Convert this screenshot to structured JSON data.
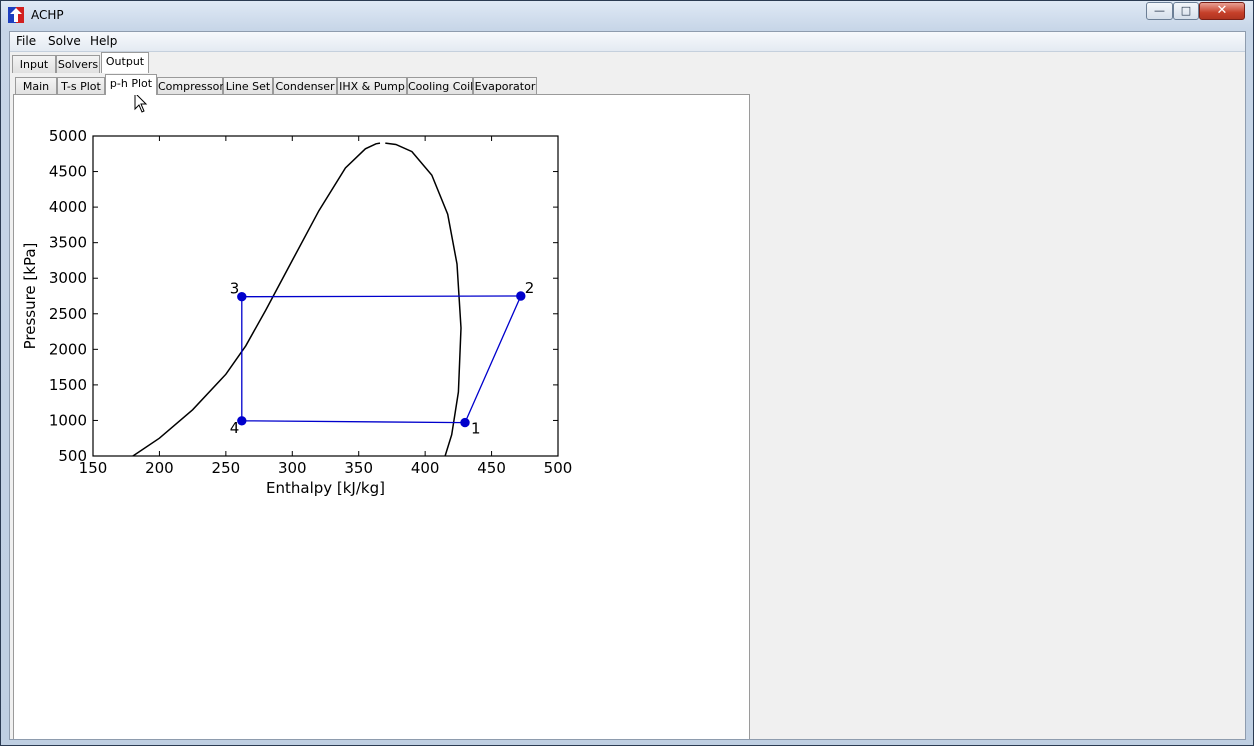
{
  "window": {
    "title": "ACHP"
  },
  "menu": [
    "File",
    "Solve",
    "Help"
  ],
  "main_tabs": [
    {
      "label": "Input"
    },
    {
      "label": "Solvers"
    },
    {
      "label": "Output",
      "selected": true
    }
  ],
  "output_tabs": [
    {
      "label": "Main"
    },
    {
      "label": "T-s Plot"
    },
    {
      "label": "p-h Plot",
      "selected": true
    },
    {
      "label": "Compressor"
    },
    {
      "label": "Line Set"
    },
    {
      "label": "Condenser"
    },
    {
      "label": "IHX & Pump"
    },
    {
      "label": "Cooling Coil"
    },
    {
      "label": "Evaporator"
    }
  ],
  "colors": {
    "cycle": "#0000cc",
    "dome": "#000000"
  },
  "chart_data": {
    "type": "line",
    "xlabel": "Enthalpy [kJ/kg]",
    "ylabel": "Pressure [kPa]",
    "xlim": [
      150,
      500
    ],
    "ylim": [
      500,
      5000
    ],
    "xticks": [
      150,
      200,
      250,
      300,
      350,
      400,
      450,
      500
    ],
    "yticks": [
      500,
      1000,
      1500,
      2000,
      2500,
      3000,
      3500,
      4000,
      4500,
      5000
    ],
    "grid": false,
    "series": [
      {
        "role": "saturation-dome-liquid",
        "x": [
          180,
          200,
          225,
          250,
          265,
          280,
          300,
          320,
          340,
          355,
          363,
          366
        ],
        "y": [
          500,
          750,
          1150,
          1650,
          2050,
          2550,
          3250,
          3950,
          4550,
          4820,
          4890,
          4900
        ]
      },
      {
        "role": "saturation-dome-vapor",
        "x": [
          370,
          378,
          390,
          405,
          417,
          424,
          427,
          425,
          420,
          415
        ],
        "y": [
          4900,
          4880,
          4780,
          4450,
          3900,
          3200,
          2300,
          1400,
          800,
          500
        ]
      },
      {
        "role": "cycle",
        "points": [
          {
            "label": "1",
            "h": 430,
            "p": 970
          },
          {
            "label": "2",
            "h": 472,
            "p": 2750
          },
          {
            "label": "3",
            "h": 262,
            "p": 2740
          },
          {
            "label": "4",
            "h": 262,
            "p": 995
          }
        ]
      }
    ]
  }
}
